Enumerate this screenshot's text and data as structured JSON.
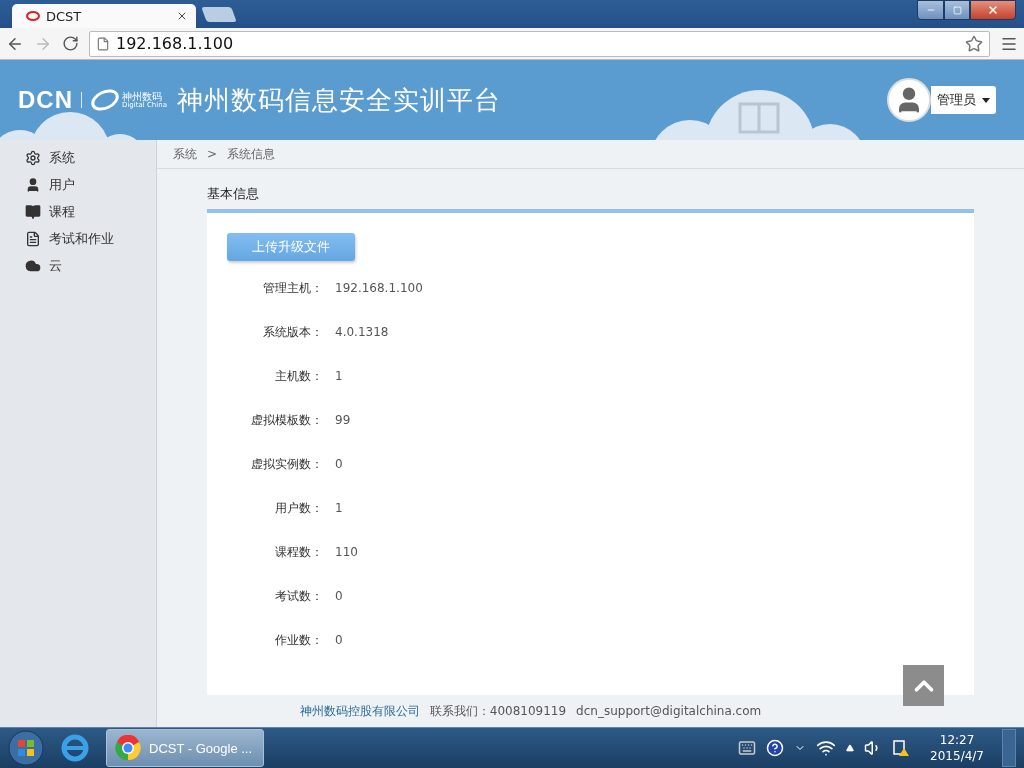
{
  "browser": {
    "tab_title": "DCST",
    "address": "192.168.1.100"
  },
  "header": {
    "logo": "DCN",
    "brand_cn": "神州数码",
    "brand_en": "Digital China",
    "title": "神州数码信息安全实训平台",
    "user": "管理员"
  },
  "sidebar": {
    "items": [
      {
        "label": "系统",
        "kind": "gear"
      },
      {
        "label": "用户",
        "kind": "user"
      },
      {
        "label": "课程",
        "kind": "book"
      },
      {
        "label": "考试和作业",
        "kind": "document"
      },
      {
        "label": "云",
        "kind": "cloud"
      }
    ]
  },
  "breadcrumb": {
    "items": [
      "系统",
      "系统信息"
    ],
    "separator": ">"
  },
  "section": {
    "title": "基本信息",
    "upload_button": "上传升级文件",
    "rows": [
      {
        "label": "管理主机：",
        "value": "192.168.1.100"
      },
      {
        "label": "系统版本：",
        "value": "4.0.1318"
      },
      {
        "label": "主机数：",
        "value": "1"
      },
      {
        "label": "虚拟模板数：",
        "value": "99"
      },
      {
        "label": "虚拟实例数：",
        "value": "0"
      },
      {
        "label": "用户数：",
        "value": "1"
      },
      {
        "label": "课程数：",
        "value": "110"
      },
      {
        "label": "考试数：",
        "value": "0"
      },
      {
        "label": "作业数：",
        "value": "0"
      }
    ]
  },
  "footer": {
    "company": "神州数码控股有限公司",
    "contact": "联系我们：4008109119",
    "email": "dcn_support@digitalchina.com"
  },
  "taskbar": {
    "window_label": "DCST - Google ...",
    "time": "12:27",
    "date": "2015/4/7"
  }
}
